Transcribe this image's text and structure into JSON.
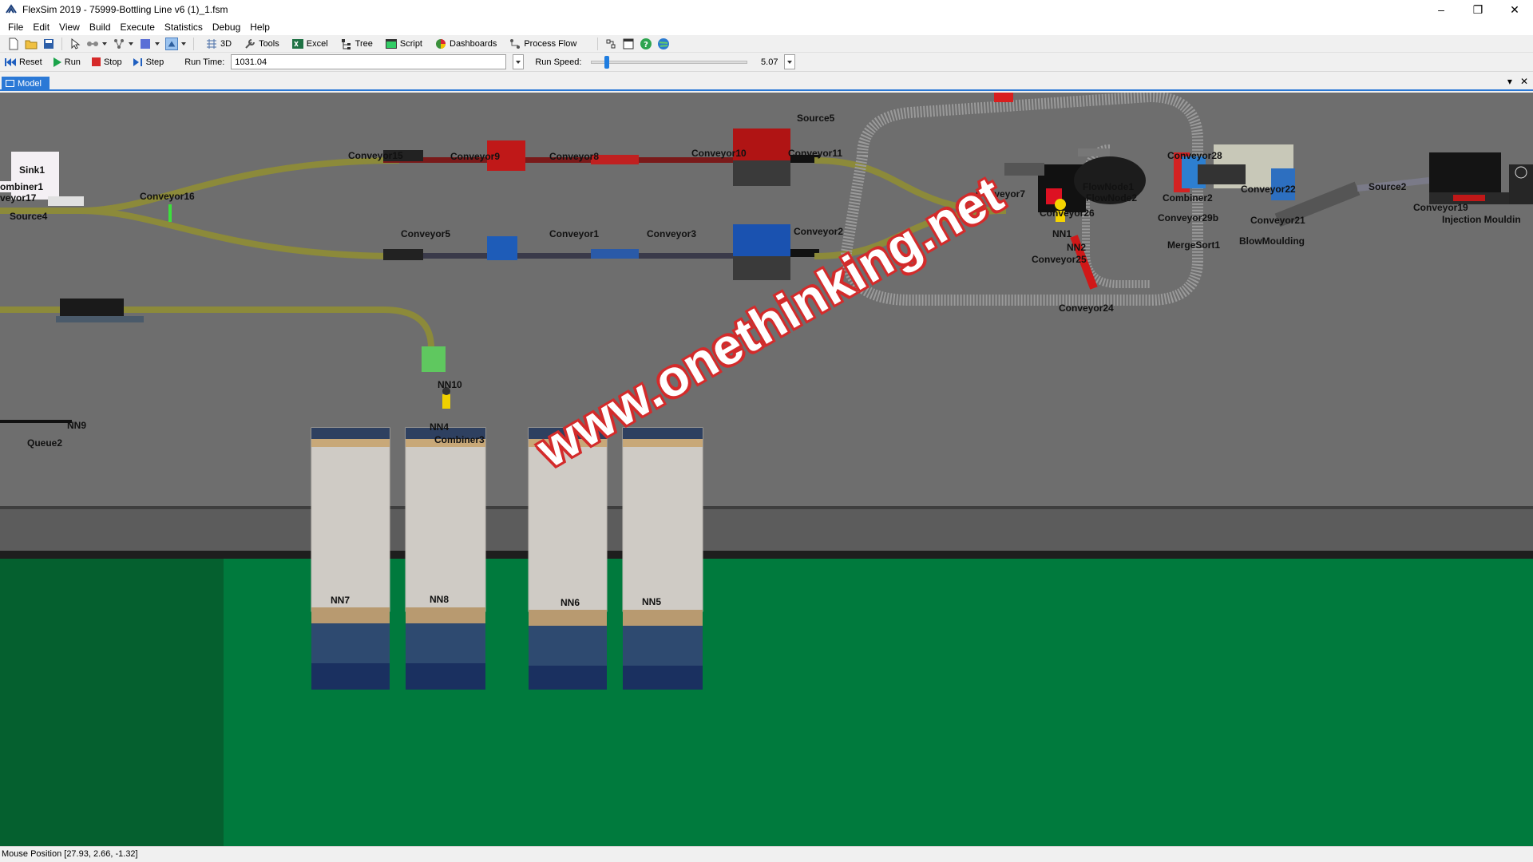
{
  "window": {
    "title": "FlexSim 2019 - 75999-Bottling Line v6 (1)_1.fsm",
    "controls": [
      "–",
      "❐",
      "✕"
    ]
  },
  "menu": [
    "File",
    "Edit",
    "View",
    "Build",
    "Execute",
    "Statistics",
    "Debug",
    "Help"
  ],
  "toolbar": {
    "buttons": {
      "view3d": "3D",
      "tools": "Tools",
      "excel": "Excel",
      "tree": "Tree",
      "script": "Script",
      "dashboards": "Dashboards",
      "process_flow": "Process Flow"
    }
  },
  "run_controls": {
    "reset": "Reset",
    "run": "Run",
    "stop": "Stop",
    "step": "Step",
    "run_time_label": "Run Time:",
    "run_time_value": "1031.04",
    "run_speed_label": "Run Speed:",
    "run_speed_value": "5.07"
  },
  "tabs": {
    "active": "Model",
    "controls": [
      "▾",
      "✕"
    ]
  },
  "model_labels": {
    "sink1": "Sink1",
    "combiner1": "ombiner1",
    "conveyor17": "veyor17",
    "source4": "Source4",
    "conveyor16": "Conveyor16",
    "conveyor15": "Conveyor15",
    "conveyor9": "Conveyor9",
    "conveyor8": "Conveyor8",
    "conveyor10": "Conveyor10",
    "conveyor11": "Conveyor11",
    "source5": "Source5",
    "conveyor5": "Conveyor5",
    "conveyor1": "Conveyor1",
    "conveyor3": "Conveyor3",
    "conveyor2": "Conveyor2",
    "conveyor7": "Conveyor7",
    "flownode1": "FlowNode1",
    "flownode2": "FlowNode2",
    "conveyor26": "Conveyor26",
    "nn1": "NN1",
    "nn2": "NN2",
    "conveyor25": "Conveyor25",
    "conveyor24": "Conveyor24",
    "conveyor28": "Conveyor28",
    "combiner2": "Combiner2",
    "conveyor29b": "Conveyor29b",
    "mergesort1": "MergeSort1",
    "conveyor22": "Conveyor22",
    "conveyor21": "Conveyor21",
    "blowmoulding": "BlowMoulding",
    "source2": "Source2",
    "conveyor19": "Conveyor19",
    "injection": "Injection Mouldin",
    "nn10": "NN10",
    "nn9": "NN9",
    "nn4": "NN4",
    "combiner3": "Combiner3",
    "queue2": "Queue2",
    "nn7": "NN7",
    "nn8": "NN8",
    "nn6": "NN6",
    "nn5": "NN5"
  },
  "watermark": "www.onethinking.net",
  "status": {
    "mouse_position": "Mouse Position [27.93, 2.66, -1.32]"
  },
  "colors": {
    "floor": "#6e6e6e",
    "ground": "#007a3d",
    "selection_tab": "#2b79d6",
    "watermark_outline": "#d32b2b"
  }
}
